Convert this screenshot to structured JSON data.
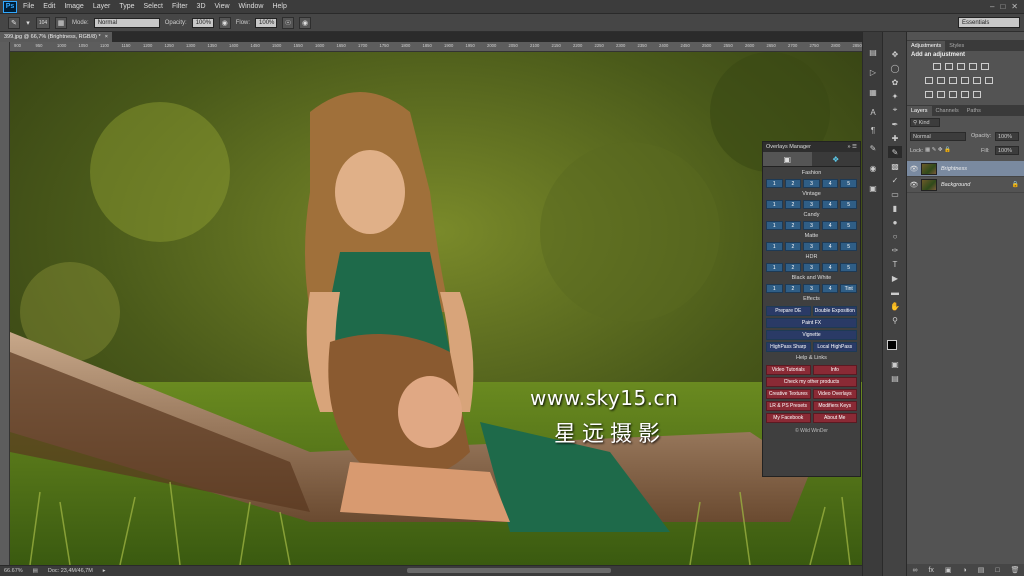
{
  "app": {
    "logo": "Ps"
  },
  "menubar": {
    "items": [
      "File",
      "Edit",
      "Image",
      "Layer",
      "Type",
      "Select",
      "Filter",
      "3D",
      "View",
      "Window",
      "Help"
    ]
  },
  "options": {
    "brush_size": "104",
    "mode_label": "Mode:",
    "mode_value": "Normal",
    "opacity_label": "Opacity:",
    "opacity_value": "100%",
    "flow_label": "Flow:",
    "flow_value": "100%",
    "workspace": "Essentials"
  },
  "document": {
    "tab_title": "399.jpg @ 66,7% (Brightness, RGB/8) *",
    "zoom": "66.67%",
    "doc_info": "Doc: 23,4M/46,7M"
  },
  "ruler": {
    "labels": [
      "900",
      "950",
      "1000",
      "1050",
      "1100",
      "1150",
      "1200",
      "1250",
      "1300",
      "1350",
      "1400",
      "1450",
      "1500",
      "1550",
      "1600",
      "1650",
      "1700",
      "1750",
      "1800",
      "1850",
      "1900",
      "1950",
      "2000",
      "2050",
      "2100",
      "2150",
      "2200",
      "2250",
      "2300",
      "2350",
      "2400",
      "2450",
      "2500",
      "2550",
      "2600",
      "2650",
      "2700",
      "2750",
      "2800",
      "2850"
    ]
  },
  "watermark": {
    "line1": "www.sky15.cn",
    "line2": "星远摄影"
  },
  "overlays_panel": {
    "title": "Overlays Manager",
    "numbers": [
      "1",
      "2",
      "3",
      "4",
      "5"
    ],
    "bw_last": "Tint",
    "sections": {
      "fashion": "Fashion",
      "vintage": "Vintage",
      "candy": "Candy",
      "matte": "Matte",
      "hdr": "HDR",
      "bw": "Black and White",
      "effects": "Effects",
      "help": "Help & Links"
    },
    "effects": {
      "prepare": "Prepare DE",
      "double": "Double Exposition",
      "paint": "Paint FX",
      "vignette": "Vignette",
      "highpass_sharp": "HighPass Sharp",
      "local_highpass": "Local HighPass"
    },
    "links": {
      "tutorials": "Video Tutorials",
      "info": "Info",
      "other": "Check my other products",
      "textures": "Creative Textures",
      "video_overlays": "Video Overlays",
      "presets": "LR & PS Presets",
      "modifiers": "Modifiers Keys",
      "facebook": "My Facebook",
      "about": "About Me"
    },
    "credit": "© Wild WinDer"
  },
  "panels": {
    "adjust_tabs": [
      "Adjustments",
      "Styles"
    ],
    "add_adjustment": "Add an adjustment",
    "layer_tabs": [
      "Layers",
      "Channels",
      "Paths"
    ],
    "kind": "Kind",
    "blend": "Normal",
    "opacity_label": "Opacity:",
    "opacity_value": "100%",
    "lock_label": "Lock:",
    "fill_label": "Fill:",
    "fill_value": "100%",
    "layers": [
      {
        "name": "Brightness"
      },
      {
        "name": "Background"
      }
    ]
  }
}
